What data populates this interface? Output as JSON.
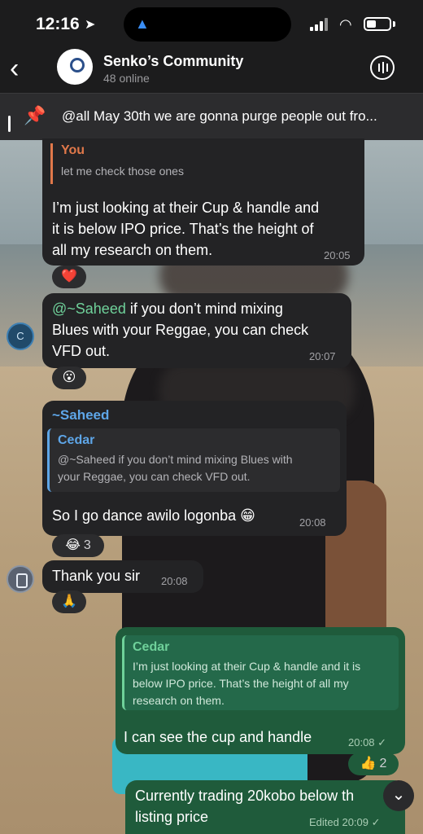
{
  "status": {
    "time": "12:16",
    "location_icon": "location-arrow-icon",
    "nav_icon": "navigation-icon"
  },
  "header": {
    "back": "‹",
    "title": "Senko’s Community",
    "subtitle": "48 online"
  },
  "pinned": {
    "text": "@all May 30th we are gonna purge people out fro..."
  },
  "messages": [
    {
      "reply_name": "You",
      "reply_text": "let me check those ones",
      "lines": [
        "I’m just looking at their Cup & handle and",
        "it is below IPO price. That’s the height of",
        "all my research on them."
      ],
      "time": "20:05",
      "reaction": "❤️"
    },
    {
      "mention": "@~Saheed",
      "lines_after_mention": " if you don’t mind mixing",
      "lines": [
        "Blues with your Reggae, you can check",
        "VFD out."
      ],
      "time": "20:07",
      "reaction": "😮",
      "avatar": "C"
    },
    {
      "sender": "~Saheed",
      "reply_name": "Cedar",
      "reply_lines": [
        "@~Saheed if you don’t mind mixing Blues with",
        "your Reggae, you can check VFD out."
      ],
      "text": "So I go dance awilo logonba 😁",
      "time": "20:08",
      "reaction": "😂",
      "reaction_count": "3"
    },
    {
      "text": "Thank you sir",
      "time": "20:08",
      "reaction": "🙏"
    },
    {
      "reply_name": "Cedar",
      "reply_lines": [
        "I’m just looking at their Cup & handle and it is",
        "below IPO price. That’s the height of all my",
        "research on them."
      ],
      "text": "I can see the cup and handle",
      "time": "20:08 ✓",
      "reaction": "👍",
      "reaction_count": "2"
    },
    {
      "lines": [
        "Currently trading 20kobo below th",
        "listing price"
      ],
      "time": "Edited 20:09 ✓"
    }
  ],
  "colors": {
    "outgoing_bubble": "#1f5b3b",
    "incoming_bubble": "#232325",
    "header": "#1c1c1d",
    "mention": "#6fd19a",
    "reply_you": "#e0784a",
    "reply_cedar": "#5ea6e8"
  }
}
